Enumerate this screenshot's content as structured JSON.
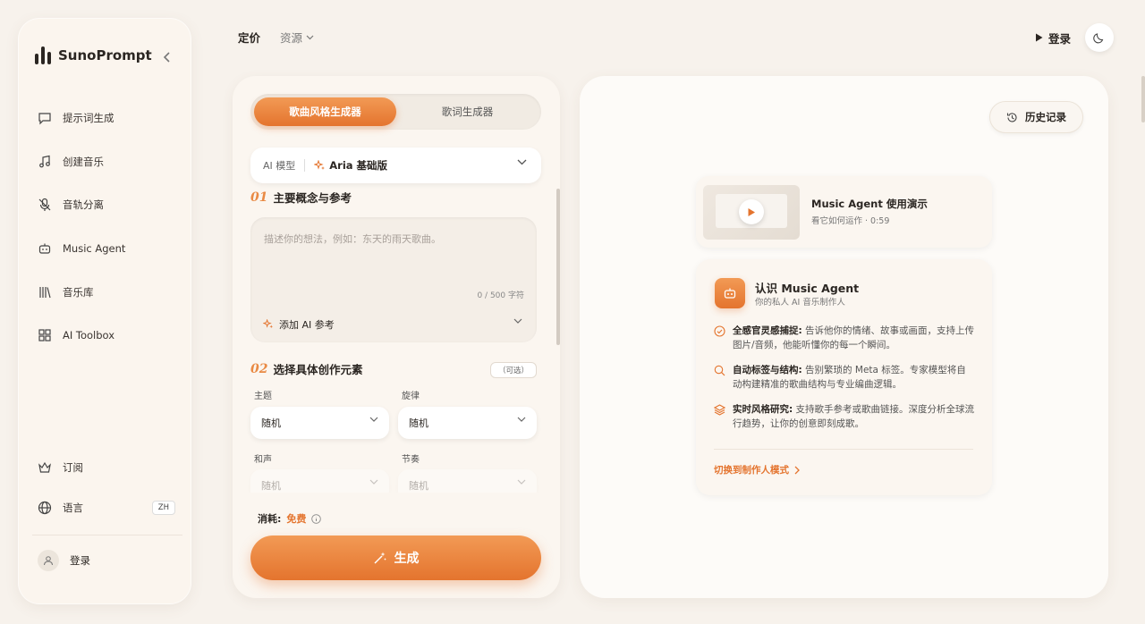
{
  "app": {
    "name": "SunoPrompt"
  },
  "sidebar": {
    "items": [
      {
        "label": "提示词生成",
        "icon": "chat-icon"
      },
      {
        "label": "创建音乐",
        "icon": "music-note-icon"
      },
      {
        "label": "音轨分离",
        "icon": "mic-off-icon"
      },
      {
        "label": "Music Agent",
        "icon": "robot-icon"
      },
      {
        "label": "音乐库",
        "icon": "library-icon"
      },
      {
        "label": "AI Toolbox",
        "icon": "grid-icon"
      }
    ],
    "subscribe_label": "订阅",
    "language_label": "语言",
    "language_badge": "ZH",
    "login_label": "登录"
  },
  "topnav": {
    "pricing": "定价",
    "resources": "资源",
    "login": "登录"
  },
  "generator": {
    "tabs": [
      "歌曲风格生成器",
      "歌词生成器"
    ],
    "model_label": "AI 模型",
    "model_value": "Aria 基础版",
    "section1_num": "01",
    "section1_title": "主要概念与参考",
    "textarea_placeholder": "描述你的想法，例如：东天的雨天歌曲。",
    "char_count": "0 / 500 字符",
    "add_reference": "添加 AI 参考",
    "section2_num": "02",
    "section2_title": "选择具体创作元素",
    "optional_tag": "（可选）",
    "fields": [
      {
        "label": "主题",
        "value": "随机"
      },
      {
        "label": "旋律",
        "value": "随机"
      },
      {
        "label": "和声",
        "value": "随机"
      },
      {
        "label": "节奏",
        "value": "随机"
      }
    ],
    "cost_label": "消耗:",
    "cost_value": "免费",
    "generate_label": "生成"
  },
  "right": {
    "history_label": "历史记录",
    "video_title": "Music Agent 使用演示",
    "video_sub": "看它如何运作 · 0:59",
    "info_title": "认识 Music Agent",
    "info_sub": "你的私人 AI 音乐制作人",
    "features": [
      {
        "title": "全感官灵感捕捉:",
        "text": "告诉他你的情绪、故事或画面，支持上传图片/音频，他能听懂你的每一个瞬间。"
      },
      {
        "title": "自动标签与结构:",
        "text": "告别繁琐的 Meta 标签。专家模型将自动构建精准的歌曲结构与专业编曲逻辑。"
      },
      {
        "title": "实时风格研究:",
        "text": "支持歌手参考或歌曲链接。深度分析全球流行趋势，让你的创意即刻成歌。"
      }
    ],
    "switch_link": "切换到制作人模式"
  },
  "colors": {
    "accent": "#e4742e",
    "accent_light": "#f29a55",
    "background": "#f7f2ec"
  }
}
